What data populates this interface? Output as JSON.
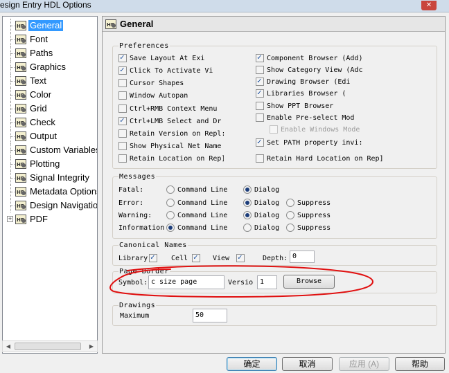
{
  "window": {
    "title": "esign Entry HDL Options",
    "close_glyph": "✕"
  },
  "tree": {
    "items": [
      {
        "label": "General",
        "selected": true
      },
      {
        "label": "Font"
      },
      {
        "label": "Paths"
      },
      {
        "label": "Graphics"
      },
      {
        "label": "Text"
      },
      {
        "label": "Color"
      },
      {
        "label": "Grid"
      },
      {
        "label": "Check"
      },
      {
        "label": "Output"
      },
      {
        "label": "Custom Variables"
      },
      {
        "label": "Plotting"
      },
      {
        "label": "Signal Integrity"
      },
      {
        "label": "Metadata Options"
      },
      {
        "label": "Design Navigation"
      },
      {
        "label": "PDF",
        "expandable": true
      }
    ],
    "expander_glyph": "+",
    "icon": "hdl-settings-icon"
  },
  "panel": {
    "title": "General"
  },
  "preferences": {
    "title": "Preferences",
    "left": [
      {
        "label": "Save Layout At Exi",
        "checked": true
      },
      {
        "label": "Click To Activate Vi",
        "checked": true
      },
      {
        "label": "Cursor Shapes",
        "checked": false
      },
      {
        "label": "Window Autopan",
        "checked": false
      },
      {
        "label": "Ctrl+RMB Context Menu",
        "checked": false
      },
      {
        "label": "Ctrl+LMB Select and Dr",
        "checked": true
      },
      {
        "label": "Retain Version on Repl:",
        "checked": false
      },
      {
        "label": "Show Physical Net Name",
        "checked": false
      },
      {
        "label": "Retain Location on Rep]",
        "checked": false
      }
    ],
    "right": [
      {
        "label": "Component Browser (Add)",
        "checked": true
      },
      {
        "label": "Show Category View (Adc",
        "checked": false
      },
      {
        "label": "Drawing Browser (Edi",
        "checked": true
      },
      {
        "label": "Libraries Browser (",
        "checked": true
      },
      {
        "label": "Show PPT Browser",
        "checked": false
      },
      {
        "label": "Enable Pre-select Mod",
        "checked": false
      },
      {
        "label": "Enable Windows Mode",
        "checked": false,
        "disabled": true
      },
      {
        "label": "Set PATH property invi:",
        "checked": true
      },
      {
        "label": "Retain Hard Location on Rep]",
        "checked": false
      }
    ]
  },
  "messages": {
    "title": "Messages",
    "rows": [
      {
        "label": "Fatal:",
        "options": [
          "Command Line",
          "Dialog"
        ],
        "selected": "Dialog"
      },
      {
        "label": "Error:",
        "options": [
          "Command Line",
          "Dialog",
          "Suppress"
        ],
        "selected": "Dialog"
      },
      {
        "label": "Warning:",
        "options": [
          "Command Line",
          "Dialog",
          "Suppress"
        ],
        "selected": "Dialog"
      },
      {
        "label": "Information",
        "options": [
          "Command Line",
          "Dialog",
          "Suppress"
        ],
        "selected": "Command Line"
      }
    ]
  },
  "canonical": {
    "title": "Canonical Names",
    "library": "Library",
    "cell": "Cell",
    "view": "View",
    "depth_label": "Depth:",
    "depth_value": "0"
  },
  "page_border": {
    "title": "Page Border",
    "symbol_label": "Symbol:",
    "symbol_value": "c size page",
    "version_label": "Versio",
    "version_value": "1",
    "browse": "Browse"
  },
  "drawings": {
    "title": "Drawings",
    "maximum_label": "Maximum",
    "maximum_value": "50"
  },
  "footer": {
    "ok": "确定",
    "cancel": "取消",
    "apply": "应用 (A)",
    "help": "帮助"
  },
  "colors": {
    "selection": "#3399ff",
    "annotation": "#e01010"
  }
}
